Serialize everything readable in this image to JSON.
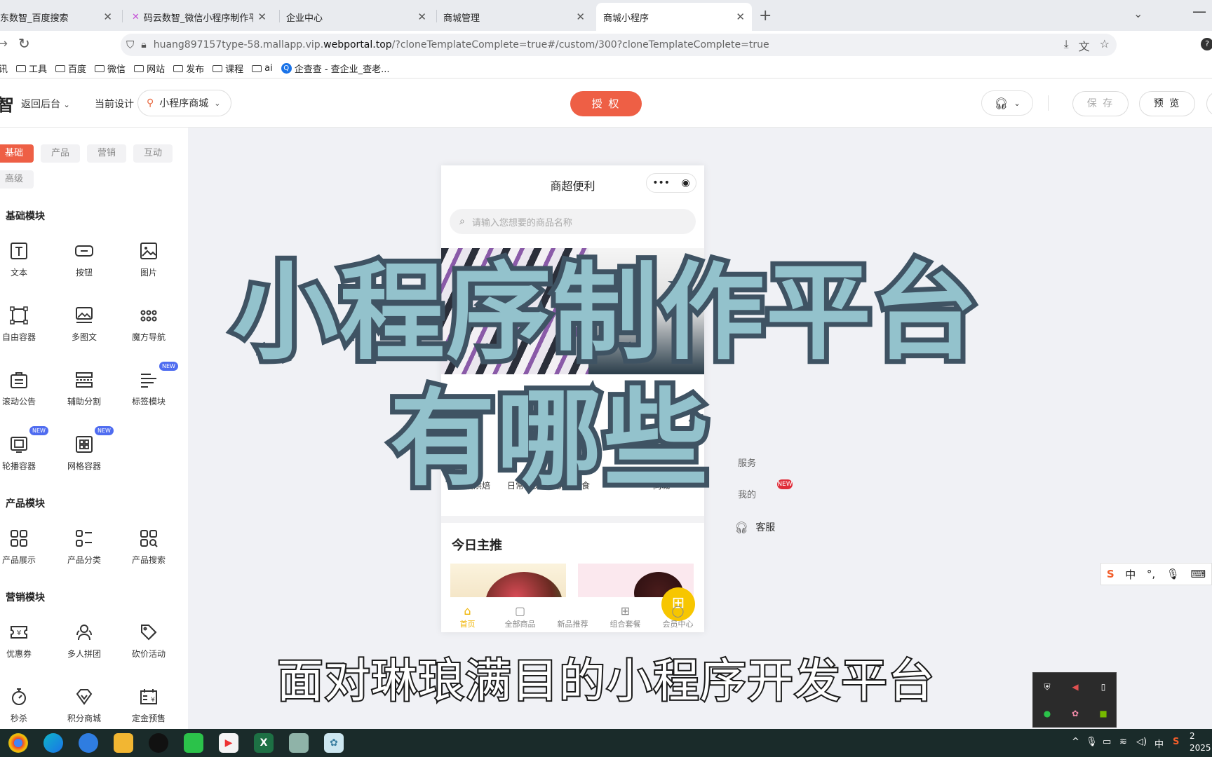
{
  "browser": {
    "tabs": [
      {
        "title": "东数智_百度搜索"
      },
      {
        "title": "码云数智_微信小程序制作平台_"
      },
      {
        "title": "企业中心"
      },
      {
        "title": "商城管理"
      },
      {
        "title": "商城小程序"
      }
    ],
    "url_pre": "huang897157type-58.mallapp.vip.",
    "url_host": "webportal.top",
    "url_post": "/?cloneTemplateComplete=true#/custom/300?cloneTemplateComplete=true",
    "bookmarks": [
      "讯",
      "工具",
      "百度",
      "微信",
      "网站",
      "发布",
      "课程",
      "ai",
      "企查查 - 查企业_查老..."
    ]
  },
  "header": {
    "logo_char": "智",
    "back_label": "返回后台",
    "current_design_label": "当前设计",
    "selector_value": "小程序商城",
    "auth_label": "授 权",
    "save_label": "保 存",
    "preview_label": "预 览"
  },
  "left_panel": {
    "category_tabs": [
      "基础",
      "产品",
      "营销",
      "互动",
      "高级"
    ],
    "sections": {
      "basic": "基础模块",
      "product": "产品模块",
      "marketing": "营销模块"
    },
    "new_badge": "NEW",
    "widgets": {
      "text": "文本",
      "button": "按钮",
      "image": "图片",
      "free_container": "自由容器",
      "multi_image_text": "多图文",
      "magic_nav": "魔方导航",
      "scroll_notice": "滚动公告",
      "divider": "辅助分割",
      "tag_module": "标签模块",
      "carousel_container": "轮播容器",
      "grid_container": "网格容器",
      "product_display": "产品展示",
      "product_category": "产品分类",
      "product_search": "产品搜索",
      "coupon": "优惠券",
      "group_buy": "多人拼团",
      "bargain": "砍价活动",
      "flash_sale": "秒杀",
      "points_mall": "积分商城",
      "deposit_presale": "定金预售"
    }
  },
  "phone": {
    "title": "商超便利",
    "capsule_menu": "•••",
    "search_placeholder": "请输入您想要的商品名称",
    "nav_items": [
      "烘焙烘焙",
      "日常百货",
      "快餐零食",
      "同城"
    ],
    "today_title": "今日主推",
    "tabs": [
      {
        "label": "首页"
      },
      {
        "label": "全部商品"
      },
      {
        "label": "新品推荐"
      },
      {
        "label": "组合套餐"
      },
      {
        "label": "会员中心"
      }
    ]
  },
  "side": {
    "customer_service": "客服",
    "ghost1": "服务",
    "ghost2": "我的",
    "badge": "NEW"
  },
  "overlay": {
    "line1": "小程序制作平台",
    "line2": "有哪些",
    "subtitle": "面对琳琅满目的小程序开发平台"
  },
  "ime": {
    "mode": "中",
    "punct": "°,"
  },
  "taskbar": {
    "ime_lang": "中",
    "clock_line1": "2",
    "clock_line2": "2025"
  },
  "colors": {
    "accent": "#ee5f45",
    "phone_active": "#f0b400",
    "overlay_fill": "#93c2cc",
    "overlay_stroke": "#3f5363"
  }
}
